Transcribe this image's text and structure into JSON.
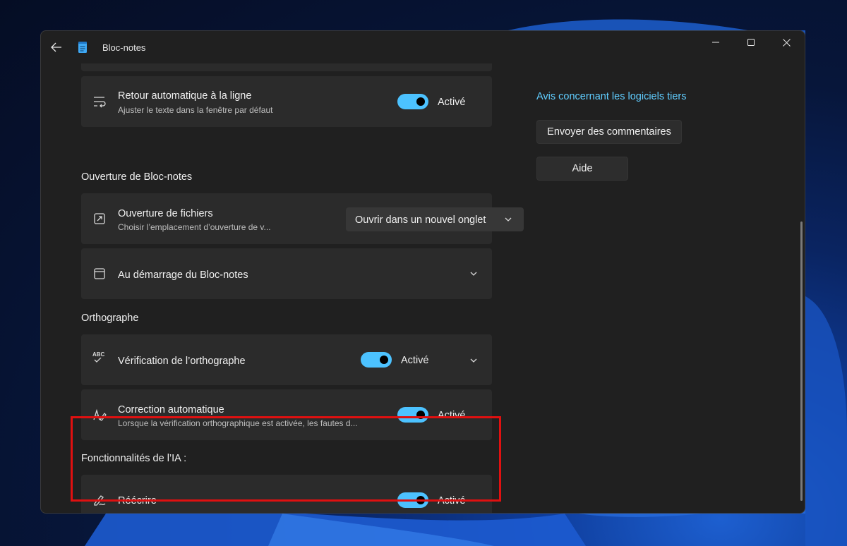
{
  "window": {
    "title": "Bloc-notes"
  },
  "settings": {
    "word_wrap": {
      "title": "Retour automatique à la ligne",
      "subtitle": "Ajuster le texte dans la fenêtre par défaut",
      "state_label": "Activé",
      "enabled": true
    },
    "opening_section": {
      "heading": "Ouverture de Bloc-notes",
      "file_opening": {
        "title": "Ouverture de fichiers",
        "subtitle": "Choisir l’emplacement d’ouverture de v...",
        "selected_option": "Ouvrir dans un nouvel onglet"
      },
      "startup": {
        "title": "Au démarrage du Bloc-notes"
      }
    },
    "spelling_section": {
      "heading": "Orthographe",
      "spell_check": {
        "title": "Vérification de l’orthographe",
        "state_label": "Activé",
        "enabled": true
      },
      "autocorrect": {
        "title": "Correction automatique",
        "subtitle": "Lorsque la vérification orthographique est activée, les fautes d...",
        "state_label": "Activé",
        "enabled": true
      }
    },
    "ai_section": {
      "heading": "Fonctionnalités de l’IA :",
      "rewrite": {
        "title": "Réécrire",
        "state_label": "Activé",
        "enabled": true
      }
    }
  },
  "side_panel": {
    "third_party_link": "Avis concernant les logiciels tiers",
    "feedback_button": "Envoyer des commentaires",
    "help_button": "Aide"
  },
  "icons": {
    "spell_check_icon_text": "ABC"
  },
  "colors": {
    "accent": "#4cc2ff",
    "link": "#60cdff",
    "highlight": "#e01010"
  }
}
